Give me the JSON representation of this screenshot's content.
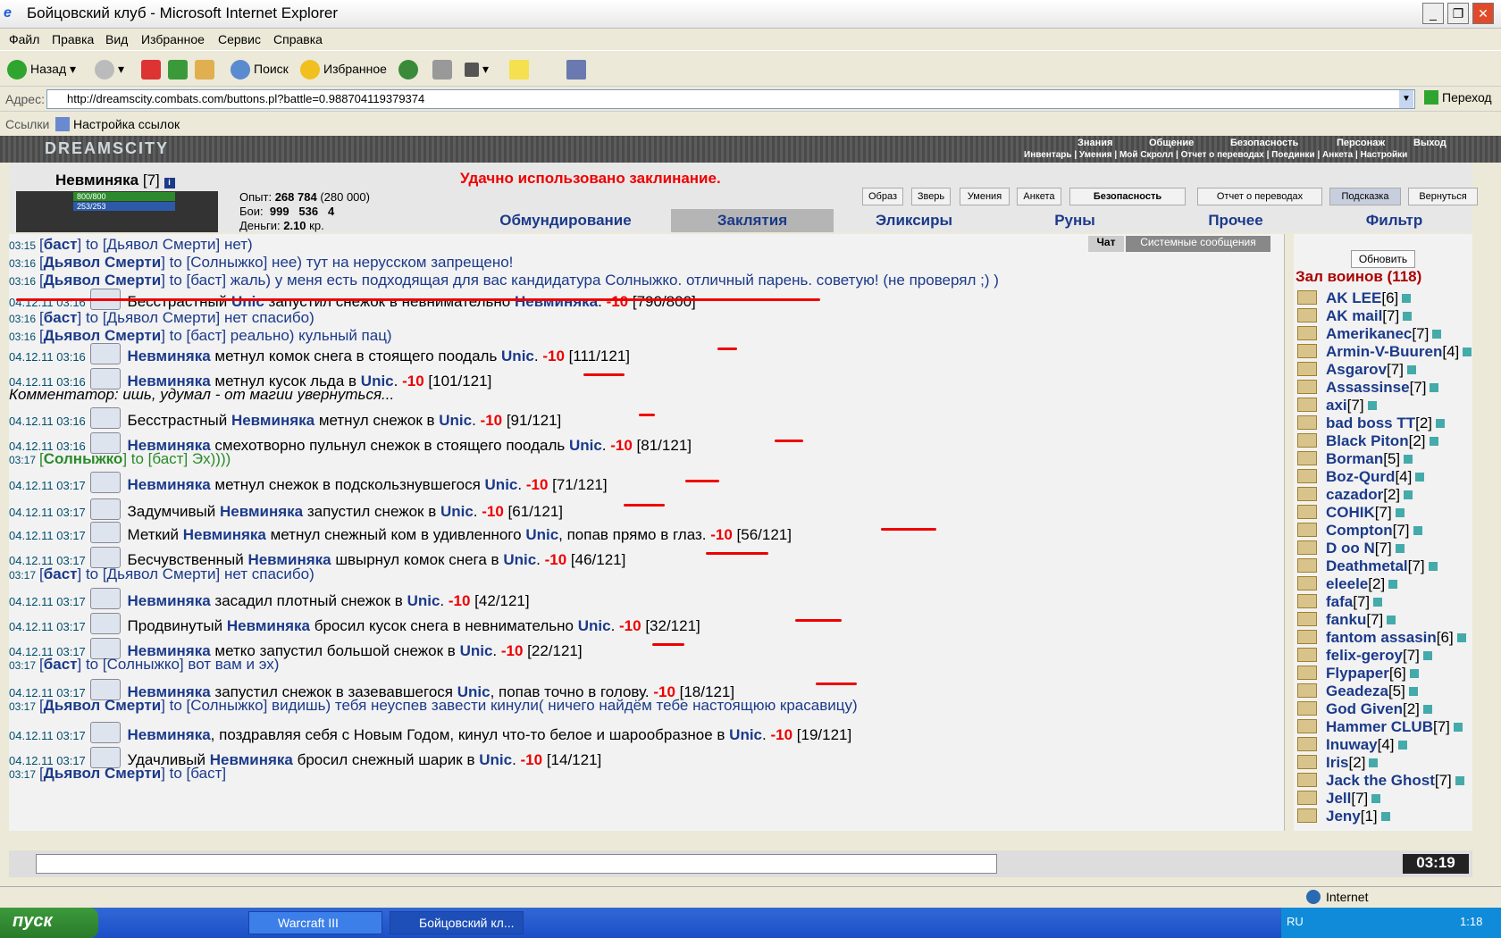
{
  "window": {
    "title": "Бойцовский клуб - Microsoft Internet Explorer"
  },
  "menu": [
    "Файл",
    "Правка",
    "Вид",
    "Избранное",
    "Сервис",
    "Справка"
  ],
  "toolbar": {
    "back": "Назад",
    "search": "Поиск",
    "favorites": "Избранное"
  },
  "address": {
    "label": "Адрес:",
    "url": "http://dreamscity.combats.com/buttons.pl?battle=0.988704119379374",
    "go": "Переход"
  },
  "links": {
    "label": "Ссылки",
    "item": "Настройка ссылок"
  },
  "game": {
    "logo": "DREAMSCITY",
    "nav_top": [
      "Знания",
      "Общение",
      "Безопасность",
      "Персонаж",
      "Выход"
    ],
    "nav_bottom": "Инвентарь | Умения | Мой Скролл | Отчет о переводах | Поединки | Анкета | Настройки"
  },
  "character": {
    "name": "Невминяка",
    "level": "[7]",
    "hp": "800/800",
    "mp": "253/253",
    "exp_label": "Опыт:",
    "exp": "268 784",
    "exp_next": "(280 000)",
    "fights_label": "Бои:",
    "wins": "999",
    "losses": "536",
    "draws": "4",
    "money_label": "Деньги:",
    "money": "2.10",
    "money_unit": "кр."
  },
  "notice": "Удачно использовано заклинание.",
  "buttons": [
    "Образ",
    "Зверь",
    "Умения",
    "Анкета",
    "Безопасность",
    "Отчет о переводах",
    "Подсказка",
    "Вернуться"
  ],
  "tabs": [
    "Обмундирование",
    "Заклятия",
    "Эликсиры",
    "Руны",
    "Прочее",
    "Фильтр"
  ],
  "chat_tabs": [
    "Чат",
    "Системные сообщения"
  ],
  "chat": [
    {
      "ts": "03:15",
      "a": "[",
      "who": "баст",
      "b": "] to [Дьявол Смерти] нет)"
    },
    {
      "ts": "03:16",
      "a": "[",
      "who": "Дьявол Смерти",
      "b": "] to [Солныжко] нее) тут на нерусском запрещено!"
    },
    {
      "ts": "03:16",
      "a": "[",
      "who": "Дьявол Смерти",
      "b": "] to [баст] жаль) у меня есть подходящая для вас кандидатура Солныжко. отличный парень. советую! (не проверял ;) )"
    },
    {
      "ts": "04.12.11 03:16",
      "sys": true,
      "pre": "Бесстрастный ",
      "who": "Unic",
      "mid": " запустил снежок в невнимательно ",
      "who2": "Невминяка",
      "post": ". ",
      "dmg": "-10",
      "hp": " [790/800]"
    },
    {
      "ts": "03:16",
      "a": "[",
      "who": "баст",
      "b": "] to [Дьявол Смерти] нет спасибо)"
    },
    {
      "ts": "03:16",
      "a": "[",
      "who": "Дьявол Смерти",
      "b": "] to [баст] реально) кульный пац)"
    },
    {
      "ts": "04.12.11 03:16",
      "sys": true,
      "pre": "",
      "who": "Невминяка",
      "mid": " метнул комок снега в стоящего поодаль ",
      "who2": "Unic",
      "post": ". ",
      "dmg": "-10",
      "hp": " [111/121]"
    },
    {
      "ts": "04.12.11 03:16",
      "sys": true,
      "pre": "",
      "who": "Невминяка",
      "mid": " метнул кусок льда в ",
      "who2": "Unic",
      "post": ". ",
      "dmg": "-10",
      "hp": " [101/121]"
    },
    {
      "comment": "Комментатор: ишь, удумал - от магии увернуться..."
    },
    {
      "ts": "04.12.11 03:16",
      "sys": true,
      "pre": "Бесстрастный ",
      "who": "Невминяка",
      "mid": " метнул снежок в ",
      "who2": "Unic",
      "post": ". ",
      "dmg": "-10",
      "hp": " [91/121]"
    },
    {
      "ts": "04.12.11 03:16",
      "sys": true,
      "pre": "",
      "who": "Невминяка",
      "mid": " смехотворно пульнул снежок в стоящего поодаль ",
      "who2": "Unic",
      "post": ". ",
      "dmg": "-10",
      "hp": " [81/121]"
    },
    {
      "ts": "03:17",
      "green": true,
      "a": "[",
      "who": "Солныжко",
      "b": "] to [баст] Эх))))"
    },
    {
      "ts": "04.12.11 03:17",
      "sys": true,
      "pre": "",
      "who": "Невминяка",
      "mid": " метнул снежок в подскользнувшегося ",
      "who2": "Unic",
      "post": ". ",
      "dmg": "-10",
      "hp": " [71/121]"
    },
    {
      "ts": "04.12.11 03:17",
      "sys": true,
      "pre": "Задумчивый ",
      "who": "Невминяка",
      "mid": " запустил снежок в ",
      "who2": "Unic",
      "post": ". ",
      "dmg": "-10",
      "hp": " [61/121]"
    },
    {
      "ts": "04.12.11 03:17",
      "sys": true,
      "pre": "Меткий ",
      "who": "Невминяка",
      "mid": " метнул снежный ком в удивленного ",
      "who2": "Unic",
      "post": ", попав прямо в глаз. ",
      "dmg": "-10",
      "hp": " [56/121]"
    },
    {
      "ts": "04.12.11 03:17",
      "sys": true,
      "pre": "Бесчувственный ",
      "who": "Невминяка",
      "mid": " швырнул комок снега в ",
      "who2": "Unic",
      "post": ". ",
      "dmg": "-10",
      "hp": " [46/121]"
    },
    {
      "ts": "03:17",
      "a": "[",
      "who": "баст",
      "b": "] to [Дьявол Смерти] нет спасибо)"
    },
    {
      "ts": "04.12.11 03:17",
      "sys": true,
      "pre": "",
      "who": "Невминяка",
      "mid": " засадил плотный снежок в ",
      "who2": "Unic",
      "post": ". ",
      "dmg": "-10",
      "hp": " [42/121]"
    },
    {
      "ts": "04.12.11 03:17",
      "sys": true,
      "pre": "Продвинутый ",
      "who": "Невминяка",
      "mid": " бросил кусок снега в невнимательно ",
      "who2": "Unic",
      "post": ". ",
      "dmg": "-10",
      "hp": " [32/121]"
    },
    {
      "ts": "04.12.11 03:17",
      "sys": true,
      "pre": "",
      "who": "Невминяка",
      "mid": " метко запустил большой снежок в ",
      "who2": "Unic",
      "post": ". ",
      "dmg": "-10",
      "hp": " [22/121]"
    },
    {
      "ts": "03:17",
      "a": "[",
      "who": "баст",
      "b": "] to [Солныжко] вот вам и эх)"
    },
    {
      "ts": "04.12.11 03:17",
      "sys": true,
      "pre": "",
      "who": "Невминяка",
      "mid": " запустил снежок в зазевавшегося ",
      "who2": "Unic",
      "post": ", попав точно в голову. ",
      "dmg": "-10",
      "hp": " [18/121]"
    },
    {
      "ts": "03:17",
      "a": "[",
      "who": "Дьявол Смерти",
      "b": "] to [Солныжко] видишь) тебя неуспев завести кинули( ничего найдём тебе настоящюю красавицу)"
    },
    {
      "ts": "04.12.11 03:17",
      "sys": true,
      "pre": "",
      "who": "Невминяка",
      "mid": ", поздравляя себя с Новым Годом, кинул что-то белое и шарообразное в ",
      "who2": "Unic",
      "post": ". ",
      "dmg": "-10",
      "hp": " [19/121]"
    },
    {
      "ts": "04.12.11 03:17",
      "sys": true,
      "pre": "Удачливый ",
      "who": "Невминяка",
      "mid": " бросил снежный шарик в ",
      "who2": "Unic",
      "post": ". ",
      "dmg": "-10",
      "hp": " [14/121]"
    },
    {
      "ts": "03:17",
      "a": "[",
      "who": "Дьявол Смерти",
      "b": "] to [баст] "
    }
  ],
  "right": {
    "refresh": "Обновить",
    "hall": "Зал воинов (118)",
    "players": [
      [
        "AK LEE",
        "[6]"
      ],
      [
        "AK mail",
        "[7]"
      ],
      [
        "Amerikanec",
        "[7]"
      ],
      [
        "Armin-V-Buuren",
        "[4]"
      ],
      [
        "Asgarov",
        "[7]"
      ],
      [
        "Assassinse",
        "[7]"
      ],
      [
        "axi",
        "[7]"
      ],
      [
        "bad boss TT",
        "[2]"
      ],
      [
        "Black Piton",
        "[2]"
      ],
      [
        "Borman",
        "[5]"
      ],
      [
        "Boz-Qurd",
        "[4]"
      ],
      [
        "cazador",
        "[2]"
      ],
      [
        "COHIK",
        "[7]"
      ],
      [
        "Compton",
        "[7]"
      ],
      [
        "D oo N",
        "[7]"
      ],
      [
        "Deathmetal",
        "[7]"
      ],
      [
        "eleele",
        "[2]"
      ],
      [
        "fafa",
        "[7]"
      ],
      [
        "fanku",
        "[7]"
      ],
      [
        "fantom assasin",
        "[6]"
      ],
      [
        "felix-gerоy",
        "[7]"
      ],
      [
        "Flypaper",
        "[6]"
      ],
      [
        "Geadeza",
        "[5]"
      ],
      [
        "God Given",
        "[2]"
      ],
      [
        "Hammer CLUB",
        "[7]"
      ],
      [
        "Inuway",
        "[4]"
      ],
      [
        "Iris",
        "[2]"
      ],
      [
        "Jack the Ghost",
        "[7]"
      ],
      [
        "Jell",
        "[7]"
      ],
      [
        "Jeny",
        "[1]"
      ]
    ]
  },
  "clock": "03:19",
  "status": {
    "zone": "Internet"
  },
  "taskbar": {
    "start": "пуск",
    "tasks": [
      "Warcraft III",
      "Бойцовский кл..."
    ],
    "lang": "RU",
    "time": "1:18"
  }
}
